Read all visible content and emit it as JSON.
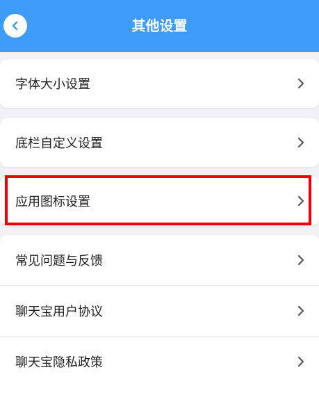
{
  "header": {
    "title": "其他设置",
    "back_icon": "chevron-left-icon",
    "color": "#3f9bf8"
  },
  "settings": {
    "items": [
      {
        "label": "字体大小设置"
      },
      {
        "label": "底栏自定义设置"
      },
      {
        "label": "应用图标设置"
      },
      {
        "label": "常见问题与反馈"
      },
      {
        "label": "聊天宝用户协议"
      },
      {
        "label": "聊天宝隐私政策"
      }
    ]
  },
  "highlight": {
    "color": "#ee0000",
    "target": "应用图标设置"
  }
}
